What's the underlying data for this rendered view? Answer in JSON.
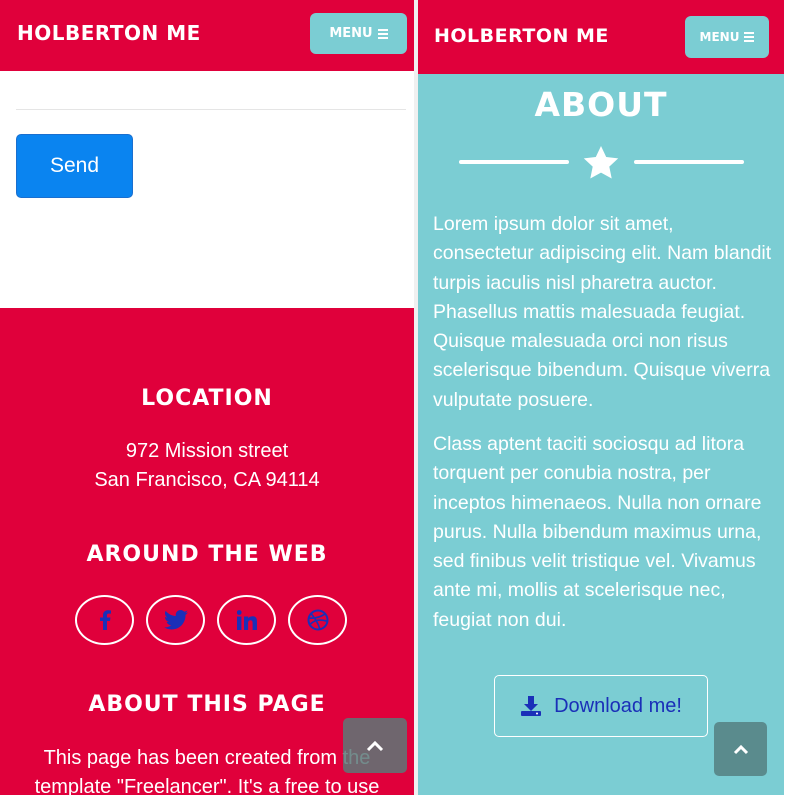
{
  "left": {
    "navbar": {
      "brand": "HOLBERTON ME",
      "menu_label": "MENU"
    },
    "form": {
      "send_label": "Send"
    },
    "footer": {
      "location_heading": "LOCATION",
      "address_line1": "972 Mission street",
      "address_line2": "San Francisco, CA 94114",
      "web_heading": "AROUND THE WEB",
      "social_icons": [
        "facebook-icon",
        "twitter-icon",
        "linkedin-icon",
        "dribbble-icon"
      ],
      "about_heading": "ABOUT THIS PAGE",
      "about_line1": "This page has been created from the",
      "about_line2": "template \"Freelancer\". It's a free to use"
    }
  },
  "right": {
    "navbar": {
      "brand": "HOLBERTON ME",
      "menu_label": "MENU"
    },
    "about": {
      "title": "ABOUT",
      "paragraph1": "Lorem ipsum dolor sit amet, consectetur adipiscing elit. Nam blandit turpis iaculis nisl pharetra auctor. Phasellus mattis malesuada feugiat. Quisque malesuada orci non risus scelerisque bibendum. Quisque viverra vulputate posuere.",
      "paragraph2": "Class aptent taciti sociosqu ad litora torquent per conubia nostra, per inceptos himenaeos. Nulla non ornare purus. Nulla bibendum maximus urna, sed finibus velit tristique vel. Vivamus ante mi, mollis at scelerisque nec, feugiat non dui.",
      "download_label": "Download me!"
    }
  },
  "colors": {
    "primary_red": "#e0003b",
    "teal": "#7bcdd3",
    "send_blue": "#0a84f0",
    "icon_blue": "#1a2fb8"
  }
}
